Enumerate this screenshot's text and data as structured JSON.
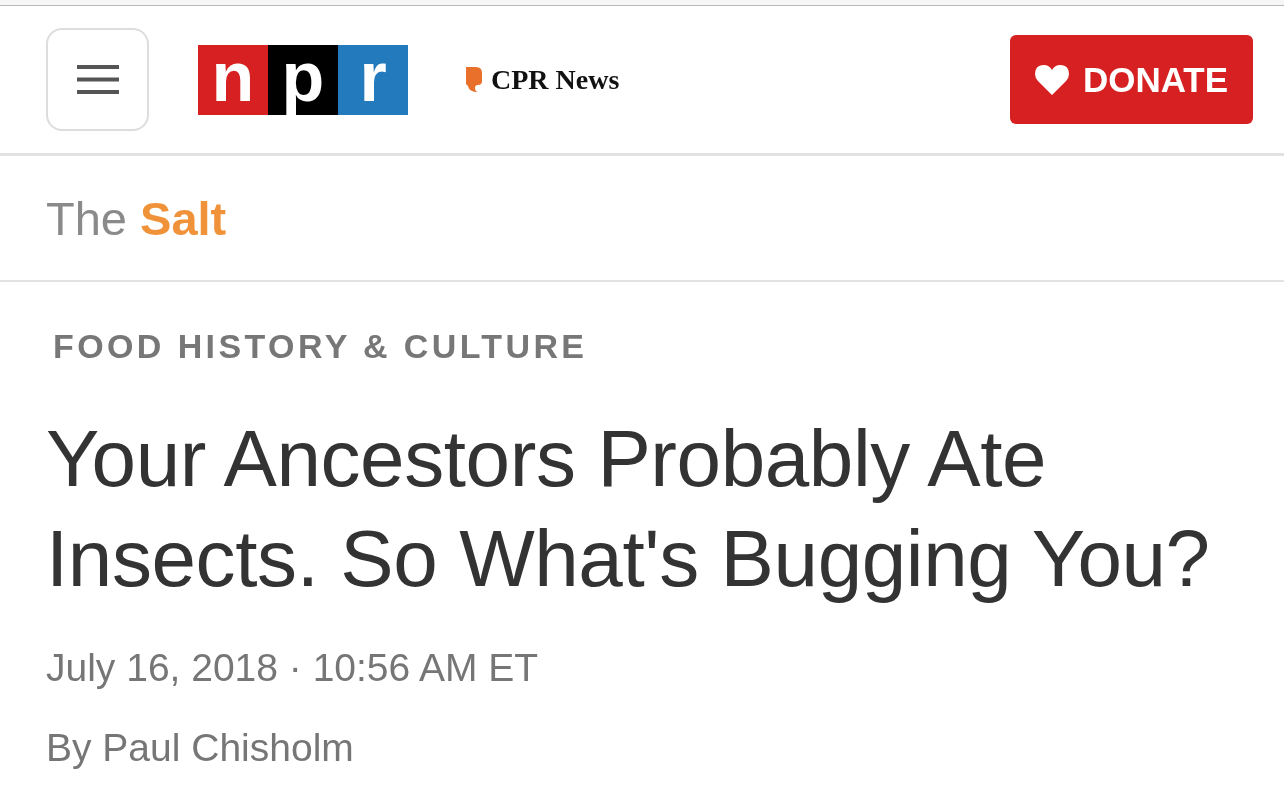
{
  "header": {
    "logo": {
      "tiles": [
        {
          "letter": "n",
          "color": "#d62021"
        },
        {
          "letter": "p",
          "color": "#000000"
        },
        {
          "letter": "r",
          "color": "#237bbd"
        }
      ]
    },
    "station": "CPR News",
    "donate_button": {
      "label": "DONATE"
    }
  },
  "section": {
    "title": "The **Salt**"
  },
  "article": {
    "category": "FOOD HISTORY & CULTURE",
    "headline": "Your Ancestors Probably Ate Insects. So What's Bugging You?",
    "dateline": "July 16, 2018 · 10:56 AM ET",
    "byline": "By Paul Chisholm"
  }
}
